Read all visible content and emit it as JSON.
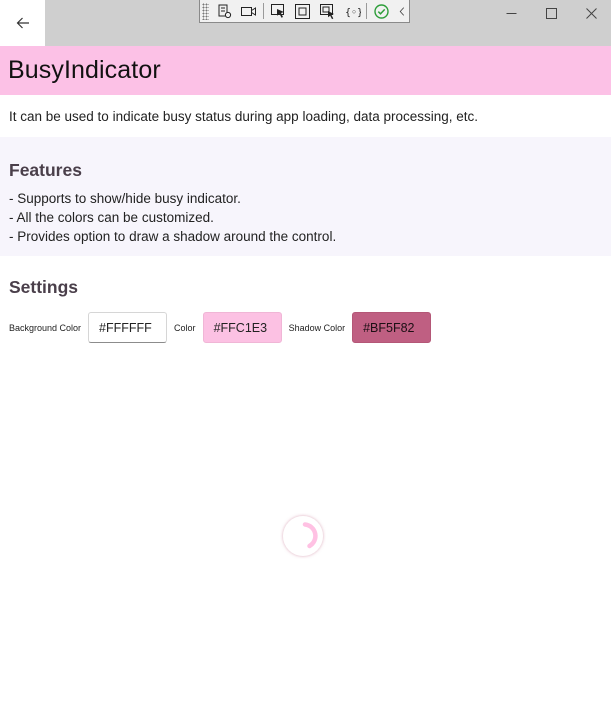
{
  "titlebar": {
    "debug_tools": [
      "live-visual-tree-icon",
      "video-icon",
      "select-element-icon",
      "display-layout-adorners-icon",
      "track-focus-icon",
      "binding-failures-icon",
      "hot-reload-ok-icon",
      "collapse-toolbar-icon"
    ]
  },
  "page": {
    "title": "BusyIndicator",
    "description": "It can be used to indicate busy status during app loading, data processing, etc."
  },
  "features": {
    "heading": "Features",
    "items": [
      "- Supports to show/hide busy indicator.",
      "- All the colors can be customized.",
      "- Provides option to draw a shadow around the control."
    ]
  },
  "settings": {
    "heading": "Settings",
    "background_color_label": "Background Color",
    "background_color_value": "#FFFFFF",
    "color_label": "Color",
    "color_value": "#FFC1E3",
    "shadow_color_label": "Shadow Color",
    "shadow_color_value": "#BF5F82"
  },
  "colors": {
    "header_bg": "#fcc1e6",
    "features_bg": "#f7f5fc",
    "indicator_color": "#FFC1E3",
    "indicator_shadow": "#BF5F82"
  }
}
